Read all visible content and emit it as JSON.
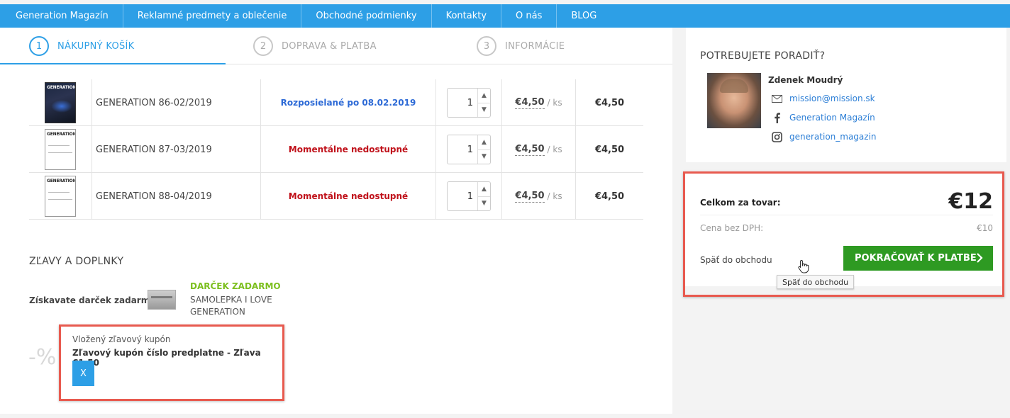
{
  "nav": {
    "items": [
      "Generation Magazín",
      "Reklamné predmety a oblečenie",
      "Obchodné podmienky",
      "Kontakty",
      "O nás",
      "BLOG"
    ]
  },
  "steps": [
    {
      "num": "1",
      "label": "NÁKUPNÝ KOŠÍK",
      "active": true
    },
    {
      "num": "2",
      "label": "DOPRAVA & PLATBA",
      "active": false
    },
    {
      "num": "3",
      "label": "INFORMÁCIE",
      "active": false
    }
  ],
  "cart": {
    "items": [
      {
        "name": "GENERATION 86-02/2019",
        "status": "Rozposielané po 08.02.2019",
        "status_color": "#2d6ad6",
        "qty": "1",
        "unit_price": "€4,50",
        "unit": "/ ks",
        "total": "€4,50"
      },
      {
        "name": "GENERATION 87-03/2019",
        "status": "Momentálne nedostupné",
        "status_color": "#c0121b",
        "qty": "1",
        "unit_price": "€4,50",
        "unit": "/ ks",
        "total": "€4,50"
      },
      {
        "name": "GENERATION 88-04/2019",
        "status": "Momentálne nedostupné",
        "status_color": "#c0121b",
        "qty": "1",
        "unit_price": "€4,50",
        "unit": "/ ks",
        "total": "€4,50"
      }
    ]
  },
  "discounts": {
    "title": "ZĽAVY A DOPLNKY",
    "gift_label": "Získavate darček zadarmo:",
    "gift_tag": "DARČEK ZADARMO",
    "gift_desc": "SAMOLEPKA I LOVE GENERATION",
    "percent_symbol": "-%",
    "coupon_title": "Vložený zľavový kupón",
    "coupon_name": "Zľavový kupón číslo predplatne - Zľava €1,50",
    "coupon_remove": "X"
  },
  "advice": {
    "title": "POTREBUJETE PORADIŤ?",
    "name": "Zdenek Moudrý",
    "email": "mission@mission.sk",
    "facebook": "Generation Magazín",
    "instagram": "generation_magazin"
  },
  "summary": {
    "total_label": "Celkom za tovar:",
    "total_value": "€12",
    "net_label": "Cena bez DPH:",
    "net_value": "€10",
    "back_label": "Späť do obchodu",
    "continue_label": "POKRAČOVAŤ K PLATBE",
    "tooltip": "Späť do obchodu"
  },
  "colors": {
    "nav": "#2d9fe6",
    "cta": "#2e9a22",
    "highlight": "#e85a4f"
  }
}
